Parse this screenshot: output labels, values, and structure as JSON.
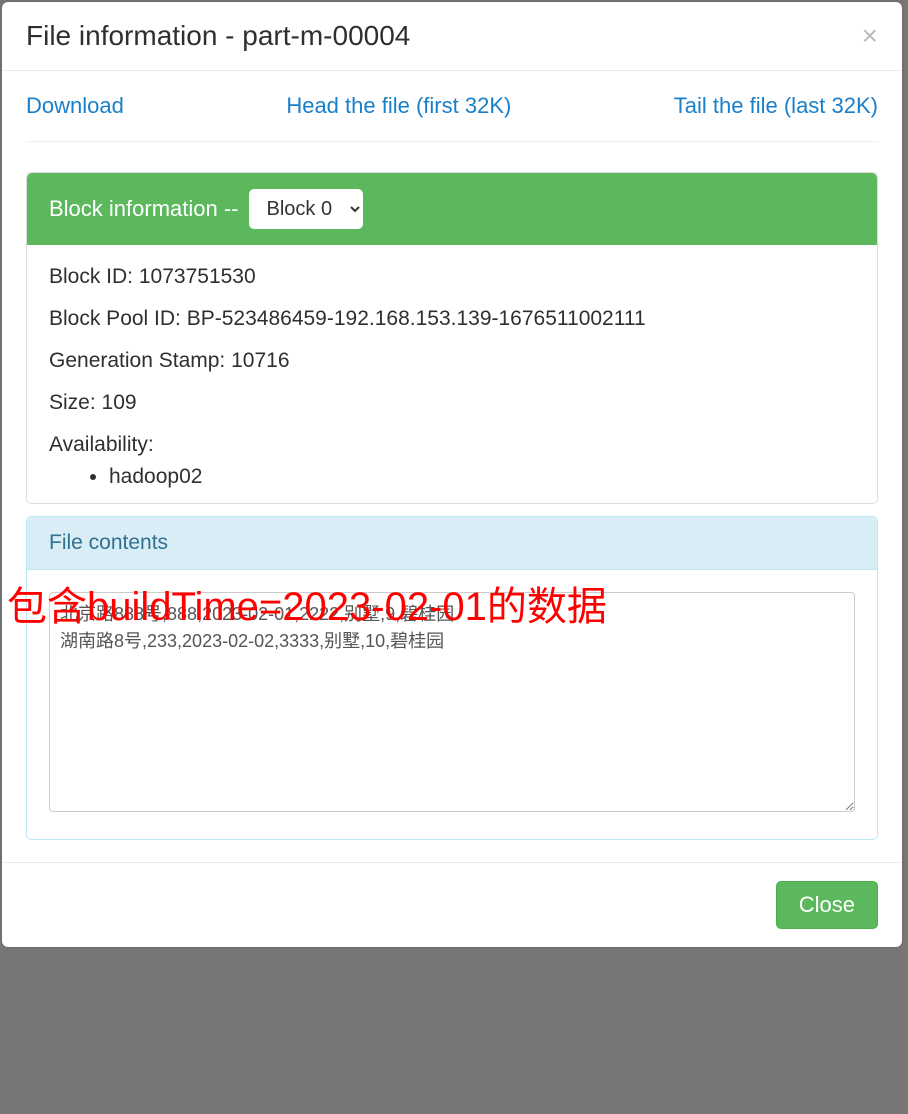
{
  "modal": {
    "title": "File information - part-m-00004",
    "close_x": "×"
  },
  "actions": {
    "download": "Download",
    "head": "Head the file (first 32K)",
    "tail": "Tail the file (last 32K)"
  },
  "block_panel": {
    "heading": "Block information -- ",
    "select_options": [
      "Block 0"
    ],
    "selected": "Block 0",
    "block_id_label": "Block ID:",
    "block_id_value": "1073751530",
    "pool_id_label": "Block Pool ID:",
    "pool_id_value": "BP-523486459-192.168.153.139-1676511002111",
    "gen_stamp_label": "Generation Stamp:",
    "gen_stamp_value": "10716",
    "size_label": "Size:",
    "size_value": "109",
    "availability_label": "Availability:",
    "availability_nodes": [
      "hadoop02"
    ]
  },
  "annotation_text": "包含buildTime=2023-02-01的数据",
  "file_contents": {
    "heading": "File contents",
    "text": "北京路888号,888,2023-02-01,2222,别墅,9,碧桂园\n湖南路8号,233,2023-02-02,3333,别墅,10,碧桂园"
  },
  "footer": {
    "close_label": "Close"
  }
}
